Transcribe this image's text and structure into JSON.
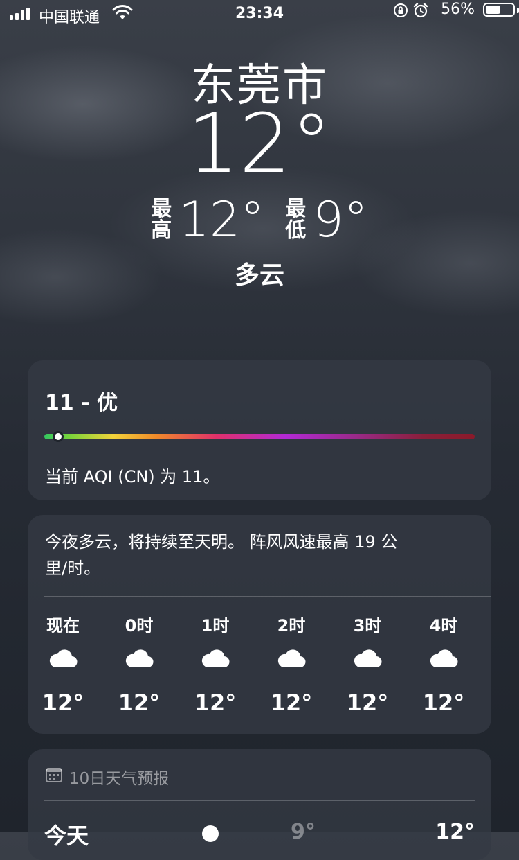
{
  "status_bar": {
    "carrier": "中国联通",
    "time": "23:34",
    "battery": "56%",
    "battery_level": 0.56
  },
  "header": {
    "city": "东莞市",
    "temperature": "12°",
    "high_label": "最高",
    "high_value": "12°",
    "low_label": "最低",
    "low_value": "9°",
    "condition": "多云"
  },
  "aqi": {
    "value_label": "11 - 优",
    "description": "当前 AQI (CN) 为 11。",
    "level": 0.02
  },
  "hourly": {
    "summary": "今夜多云，将持续至天明。 阵风风速最高 19 公里/时。",
    "items": [
      {
        "label": "现在",
        "icon": "cloud-icon",
        "temp": "12°"
      },
      {
        "label": "0时",
        "icon": "cloud-icon",
        "temp": "12°"
      },
      {
        "label": "1时",
        "icon": "cloud-icon",
        "temp": "12°"
      },
      {
        "label": "2时",
        "icon": "cloud-icon",
        "temp": "12°"
      },
      {
        "label": "3时",
        "icon": "cloud-icon",
        "temp": "12°"
      },
      {
        "label": "4时",
        "icon": "cloud-icon",
        "temp": "12°"
      }
    ]
  },
  "ten_day": {
    "title": "10日天气预报",
    "rows": [
      {
        "day": "今天",
        "low": "9°",
        "high": "12°"
      }
    ]
  }
}
